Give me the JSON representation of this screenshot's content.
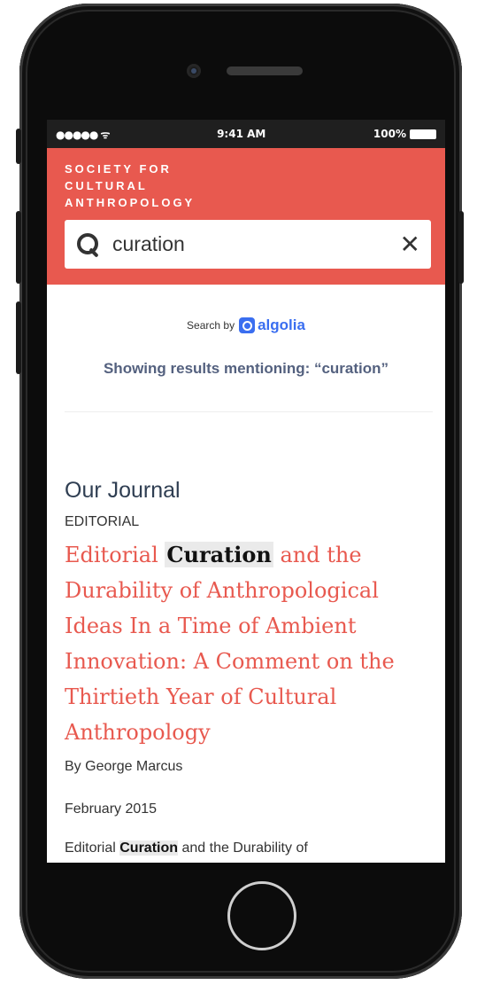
{
  "status_bar": {
    "signal": "●●●●● ᯤ",
    "time": "9:41 AM",
    "battery": "100%"
  },
  "header": {
    "brand_lines": [
      "SOCIETY FOR",
      "CULTURAL",
      "ANTHROPOLOGY"
    ],
    "search": {
      "value": "curation",
      "clear": "✕"
    }
  },
  "algolia": {
    "prefix": "Search by",
    "name": "algolia"
  },
  "showing_text": "Showing results mentioning: “curation”",
  "results": {
    "section_title": "Our Journal",
    "category": "EDITORIAL",
    "title_before": "Editorial ",
    "title_highlight": "Curation",
    "title_after": " and the Durability of Anthropological Ideas In a Time of Ambient Innovation: A Comment on the Thirtieth Year of Cultural Anthropology",
    "author": "By George Marcus",
    "date": "February 2015",
    "excerpt_before": "Editorial ",
    "excerpt_highlight": "Curation",
    "excerpt_after": " and the Durability of"
  },
  "colors": {
    "brand": "#e8594f",
    "algolia": "#3a6ef0",
    "showing": "#54617f"
  }
}
